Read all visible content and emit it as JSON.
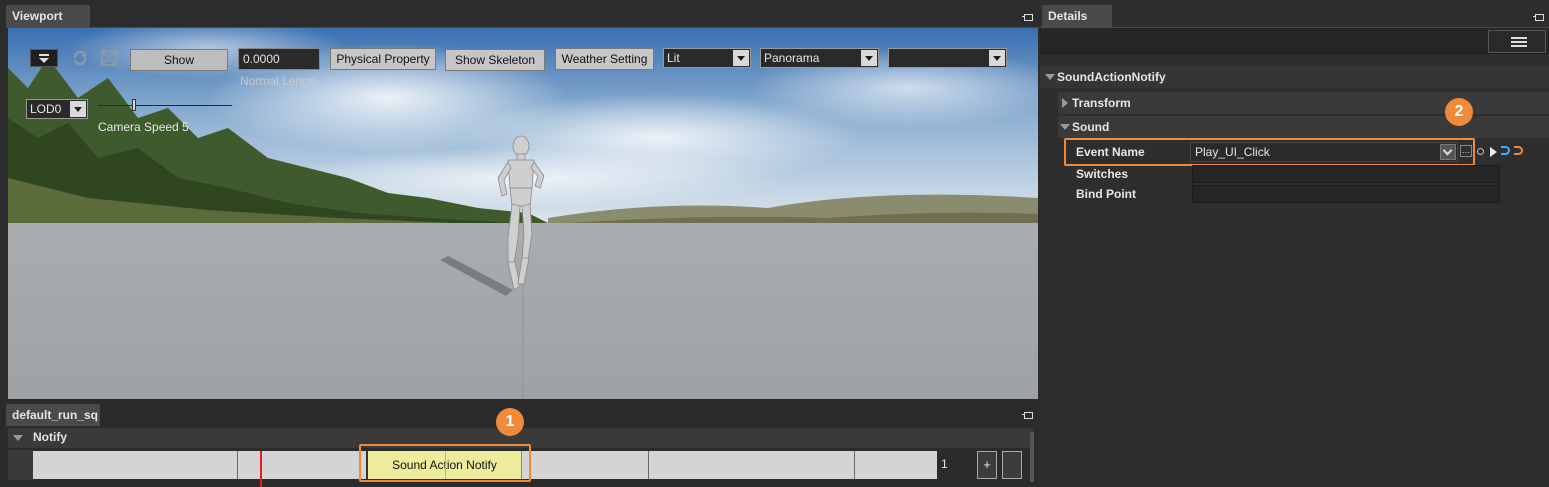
{
  "viewport": {
    "tab_title": "Viewport",
    "toolbar": {
      "show_label": "Show",
      "normal_length_value": "0.0000",
      "normal_length_label": "Normal Length",
      "physical_property_label": "Physical Property",
      "show_skeleton_label": "Show Skeleton",
      "weather_setting_label": "Weather Setting",
      "lighting_mode": "Lit",
      "camera_mode": "Panorama",
      "third_dropdown": "",
      "lod_value": "LOD0",
      "camera_speed_label": "Camera Speed 5"
    }
  },
  "sequence": {
    "tab_title": "default_run_sq",
    "track_group_label": "Notify",
    "notify_block_label": "Sound Action Notify",
    "frame_count": "1",
    "add_button_label": "+",
    "callout_1": "1"
  },
  "details": {
    "tab_title": "Details",
    "section_title": "SoundActionNotify",
    "categories": [
      {
        "label": "Transform",
        "expanded": false
      },
      {
        "label": "Sound",
        "expanded": true
      }
    ],
    "properties": {
      "event_name_label": "Event Name",
      "event_name_value": "Play_UI_Click",
      "switches_label": "Switches",
      "bind_point_label": "Bind Point"
    },
    "callout_2": "2"
  },
  "colors": {
    "accent_orange": "#ee8a3a",
    "notify_block": "#ecec9c",
    "playhead": "#e02020",
    "reset_arrow": "#3ab0ff"
  },
  "icons": [
    "dropdown-menu-icon",
    "rotate-icon",
    "fullscreen-icon",
    "pin-icon",
    "hamburger-icon",
    "browse-icon",
    "expand-arrow-icon"
  ]
}
